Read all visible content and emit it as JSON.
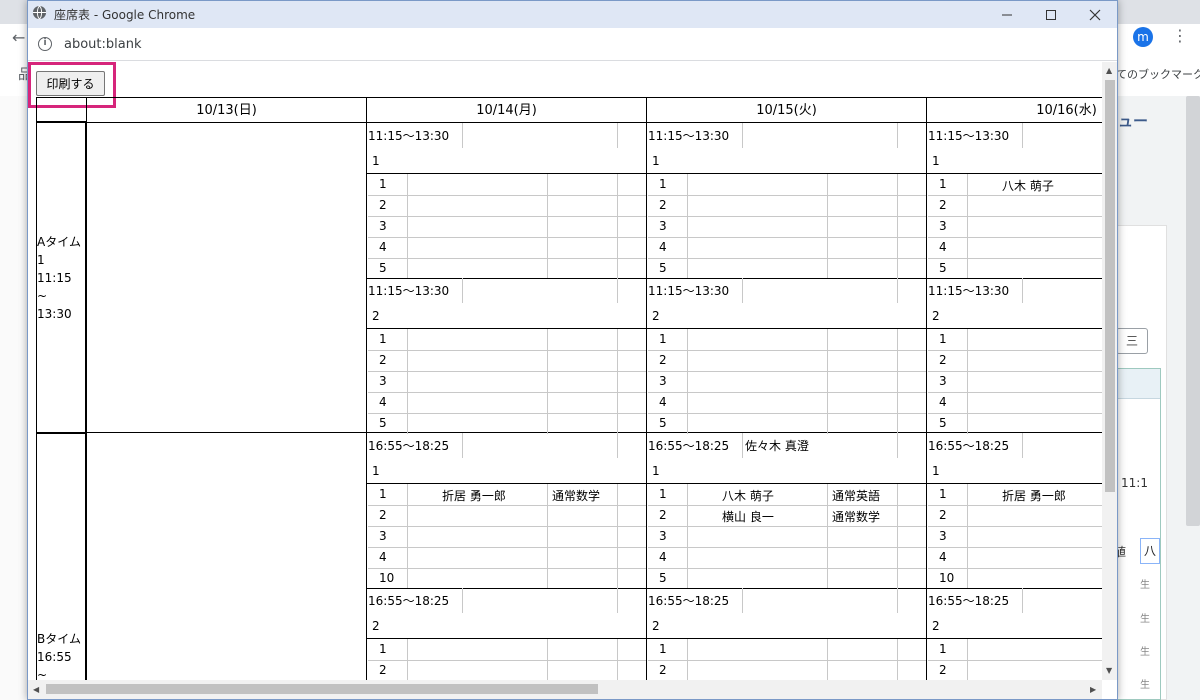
{
  "background": {
    "bookmarks_text": "てのブックマーク",
    "avatar_letter": "m",
    "menu_text": "ュー",
    "button_text": "三",
    "time_text": "11:1",
    "field_label": "値",
    "field_value": "八",
    "row_labels": [
      "生",
      "生",
      "生",
      "生"
    ],
    "cut_left_text": "品"
  },
  "window": {
    "title": "座席表 - Google Chrome",
    "url": "about:blank"
  },
  "page": {
    "print_button": "印刷する",
    "dates": [
      "10/13(日)",
      "10/14(月)",
      "10/15(火)",
      "10/16(水)"
    ],
    "row_headers": {
      "a": [
        "Aタイム",
        "1",
        "11:15",
        "~",
        "13:30"
      ],
      "b": [
        "Bタイム",
        "16:55",
        "~"
      ]
    },
    "blocks": {
      "a1": {
        "time": "11:15～13:30",
        "room": "1",
        "seats": [
          "1",
          "2",
          "3",
          "4",
          "5"
        ],
        "d15_name": "",
        "d16_row1_name": "八木 萌子"
      },
      "a2": {
        "time": "11:15～13:30",
        "room": "2",
        "seats": [
          "1",
          "2",
          "3",
          "4",
          "5"
        ]
      },
      "b1": {
        "time": "16:55～18:25",
        "room": "1",
        "d14_seats": [
          "1",
          "2",
          "3",
          "4",
          "10"
        ],
        "d15_seats": [
          "1",
          "2",
          "3",
          "4",
          "5"
        ],
        "d16_seats": [
          "1",
          "2",
          "3",
          "4",
          "10"
        ],
        "d14_row1_name": "折居 勇一郎",
        "d14_row1_subject": "通常数学",
        "d15_header_name": "佐々木 真澄",
        "d15_row1_name": "八木 萌子",
        "d15_row1_subject": "通常英語",
        "d15_row2_name": "横山 良一",
        "d15_row2_subject": "通常数学",
        "d16_row1_name": "折居 勇一郎"
      },
      "b2": {
        "time": "16:55～18:25",
        "room": "2",
        "seats": [
          "1",
          "2"
        ]
      }
    }
  }
}
